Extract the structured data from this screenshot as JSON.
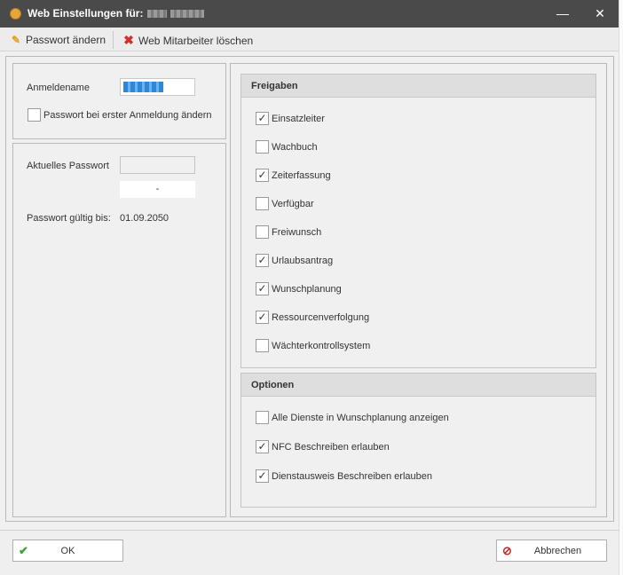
{
  "window": {
    "title": "Web Einstellungen für:",
    "close_glyph": "✕",
    "minimize_glyph": "—"
  },
  "toolbar": {
    "change_password": "Passwort ändern",
    "delete_employee": "Web Mitarbeiter löschen"
  },
  "login": {
    "username_label": "Anmeldename",
    "change_on_first_login": "Passwort bei erster Anmeldung ändern",
    "change_on_first_login_checked": false
  },
  "password": {
    "current_label": "Aktuelles Passwort",
    "current_display": "-",
    "valid_until_label": "Passwort gültig bis:",
    "valid_until_value": "01.09.2050"
  },
  "freigaben": {
    "title": "Freigaben",
    "items": [
      {
        "label": "Einsatzleiter",
        "checked": true
      },
      {
        "label": "Wachbuch",
        "checked": false
      },
      {
        "label": "Zeiterfassung",
        "checked": true
      },
      {
        "label": "Verfügbar",
        "checked": false
      },
      {
        "label": "Freiwunsch",
        "checked": false
      },
      {
        "label": "Urlaubsantrag",
        "checked": true
      },
      {
        "label": "Wunschplanung",
        "checked": true
      },
      {
        "label": "Ressourcenverfolgung",
        "checked": true
      },
      {
        "label": "Wächterkontrollsystem",
        "checked": false
      }
    ]
  },
  "optionen": {
    "title": "Optionen",
    "items": [
      {
        "label": "Alle Dienste in Wunschplanung anzeigen",
        "checked": false
      },
      {
        "label": "NFC Beschreiben erlauben",
        "checked": true
      },
      {
        "label": "Dienstausweis Beschreiben erlauben",
        "checked": true
      }
    ]
  },
  "buttons": {
    "ok": "OK",
    "cancel": "Abbrechen"
  },
  "colors": {
    "titlebar": "#4a4a4a",
    "ok_icon": "#3aa53a",
    "cancel_icon": "#c62828",
    "delete_icon": "#d32f2f",
    "edit_icon": "#e6a020"
  }
}
